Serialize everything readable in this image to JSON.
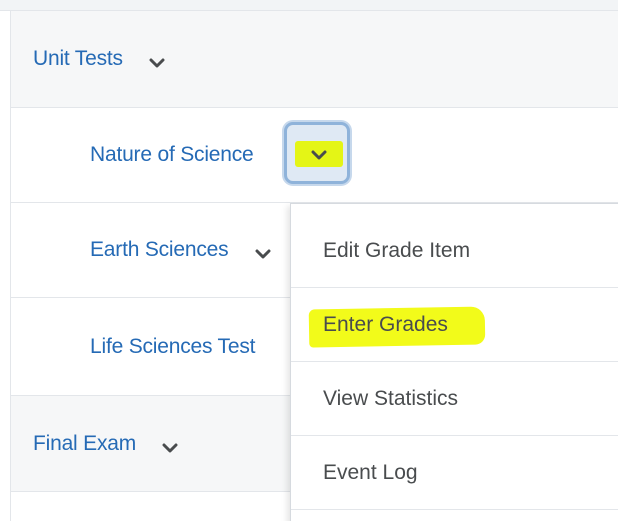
{
  "grade_items": {
    "unit_tests": {
      "label": "Unit Tests",
      "toggle_icon": "chevron-down-icon"
    },
    "nature_of_science": {
      "label": "Nature of Science",
      "toggle_icon": "chevron-down-icon"
    },
    "earth_sciences": {
      "label": "Earth Sciences",
      "toggle_icon": "chevron-down-icon"
    },
    "life_sciences_test": {
      "label": "Life Sciences Test"
    },
    "final_exam": {
      "label": "Final Exam",
      "toggle_icon": "chevron-down-icon"
    }
  },
  "context_menu": {
    "items": [
      {
        "label": "Edit Grade Item"
      },
      {
        "label": "Enter Grades",
        "highlighted": true
      },
      {
        "label": "View Statistics"
      },
      {
        "label": "Event Log"
      }
    ]
  },
  "colors": {
    "link_text": "#256ab5",
    "menu_text": "#494c4e",
    "highlighter": "#f2fb1a",
    "focus_ring": "#8fb3da"
  }
}
